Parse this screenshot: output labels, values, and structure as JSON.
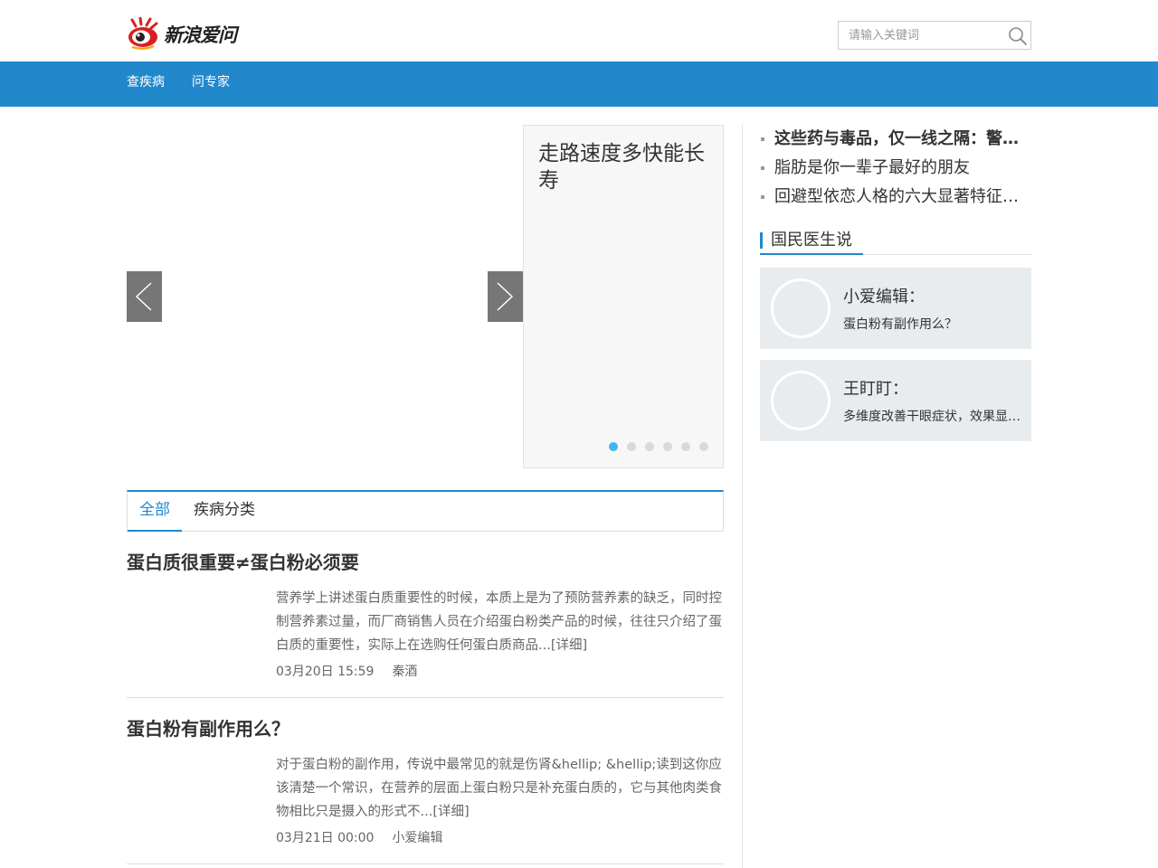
{
  "header": {
    "logo_text": "新浪爱问",
    "search": {
      "placeholder": "请输入关键词"
    }
  },
  "nav": {
    "items": [
      {
        "label": "查疾病"
      },
      {
        "label": "问专家"
      }
    ]
  },
  "slider": {
    "current_title": "走路速度多快能长寿",
    "slide_count": 6,
    "active_index": 0
  },
  "tabs": [
    {
      "label": "全部",
      "active": true
    },
    {
      "label": "疾病分类",
      "active": false
    }
  ],
  "articles": [
    {
      "title": "蛋白质很重要≠蛋白粉必须要",
      "summary": "营养学上讲述蛋白质重要性的时候，本质上是为了预防营养素的缺乏，同时控制营养素过量，而厂商销售人员在介绍蛋白粉类产品的时候，往往只介绍了蛋白质的重要性，实际上在选购任何蛋白质商品...",
      "detail": "[详细]",
      "time": "03月20日 15:59",
      "author": "秦酒"
    },
    {
      "title": "蛋白粉有副作用么？",
      "summary": "对于蛋白粉的副作用，传说中最常见的就是伤肾&hellip; &hellip;读到这你应该清楚一个常识，在营养的层面上蛋白粉只是补充蛋白质的，它与其他肉类食物相比只是摄入的形式不...",
      "detail": "[详细]",
      "time": "03月21日 00:00",
      "author": "小爱编辑"
    }
  ],
  "sidebar": {
    "hot_items": [
      {
        "text": "这些药与毒品，仅一线之隔：警惕药物成瘾",
        "bold": true
      },
      {
        "text": "脂肪是你一辈子最好的朋友",
        "bold": false
      },
      {
        "text": "回避型依恋人格的六大显著特征与表现",
        "bold": false
      }
    ],
    "section_title": "国民医生说",
    "doctors": [
      {
        "name": "小爱编辑：",
        "quote": "蛋白粉有副作用么？"
      },
      {
        "name": "王盯盯：",
        "quote": "多维度改善干眼症状，效果显著提升生活质量"
      }
    ]
  },
  "colors": {
    "brand_blue": "#2188cc",
    "active_dot": "#41b4ee",
    "logo_red": "#d9201f"
  }
}
